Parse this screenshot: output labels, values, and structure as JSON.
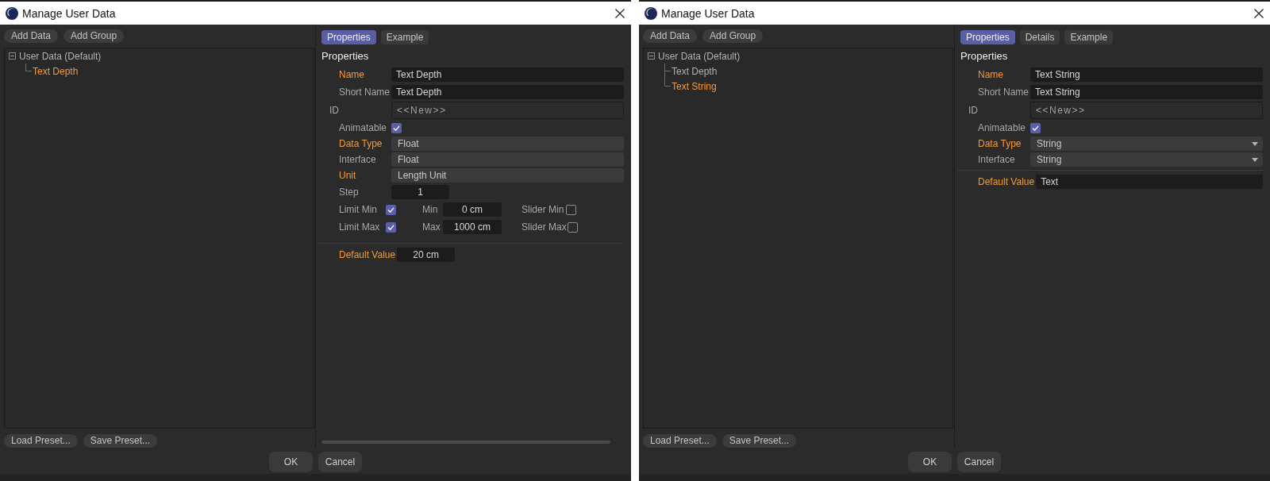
{
  "dialogs": [
    {
      "title": "Manage User Data",
      "toolbar": [
        "Add Data",
        "Add Group"
      ],
      "tree": {
        "label": "User Data (Default)",
        "expanded": true,
        "children": [
          {
            "label": "Text Depth",
            "selected": true
          }
        ]
      },
      "preset_buttons": [
        "Load Preset...",
        "Save Preset..."
      ],
      "tabs": [
        {
          "label": "Properties",
          "selected": true
        },
        {
          "label": "Example",
          "selected": false
        }
      ],
      "heading": "Properties",
      "rows": [
        {
          "kind": "text",
          "label": "Name",
          "highlighted": true,
          "value": "Text Depth"
        },
        {
          "kind": "text",
          "label": "Short Name",
          "highlighted": false,
          "value": "Text Depth"
        },
        {
          "kind": "id",
          "label": "ID",
          "highlighted": false,
          "value": "<<New>>"
        },
        {
          "kind": "checkbox",
          "label": "Animatable",
          "highlighted": false,
          "checked": true
        },
        {
          "kind": "choice",
          "label": "Data Type",
          "highlighted": true,
          "value": "Float"
        },
        {
          "kind": "choice",
          "label": "Interface",
          "highlighted": false,
          "value": "Float"
        },
        {
          "kind": "choice",
          "label": "Unit",
          "highlighted": true,
          "value": "Length Unit"
        },
        {
          "kind": "number",
          "label": "Step",
          "highlighted": false,
          "value": "1"
        },
        {
          "kind": "limit",
          "label": "Limit Min",
          "highlighted": false,
          "checked": true,
          "bound_label": "Min",
          "value": "0 cm",
          "slider_label": "Slider Min",
          "slider_checked": false
        },
        {
          "kind": "limit",
          "label": "Limit Max",
          "highlighted": false,
          "checked": true,
          "bound_label": "Max",
          "value": "1000 cm",
          "slider_label": "Slider Max",
          "slider_checked": false
        },
        {
          "kind": "separator"
        },
        {
          "kind": "number",
          "label": "Default Value",
          "highlighted": true,
          "value": "20 cm"
        }
      ],
      "scrollbar": true,
      "buttons": [
        "OK",
        "Cancel"
      ]
    },
    {
      "title": "Manage User Data",
      "toolbar": [
        "Add Data",
        "Add Group"
      ],
      "tree": {
        "label": "User Data (Default)",
        "expanded": true,
        "children": [
          {
            "label": "Text Depth",
            "selected": false
          },
          {
            "label": "Text String",
            "selected": true
          }
        ]
      },
      "preset_buttons": [
        "Load Preset...",
        "Save Preset..."
      ],
      "tabs": [
        {
          "label": "Properties",
          "selected": true
        },
        {
          "label": "Details",
          "selected": false
        },
        {
          "label": "Example",
          "selected": false
        }
      ],
      "heading": "Properties",
      "rows": [
        {
          "kind": "text",
          "label": "Name",
          "highlighted": true,
          "value": "Text String"
        },
        {
          "kind": "text",
          "label": "Short Name",
          "highlighted": false,
          "value": "Text String"
        },
        {
          "kind": "id",
          "label": "ID",
          "highlighted": false,
          "value": "<<New>>"
        },
        {
          "kind": "checkbox",
          "label": "Animatable",
          "highlighted": false,
          "checked": true
        },
        {
          "kind": "dropdown",
          "label": "Data Type",
          "highlighted": true,
          "value": "String"
        },
        {
          "kind": "dropdown",
          "label": "Interface",
          "highlighted": false,
          "value": "String"
        },
        {
          "kind": "separator"
        },
        {
          "kind": "text",
          "label": "Default Value",
          "highlighted": true,
          "value": "Text"
        }
      ],
      "buttons": [
        "OK",
        "Cancel"
      ]
    }
  ]
}
